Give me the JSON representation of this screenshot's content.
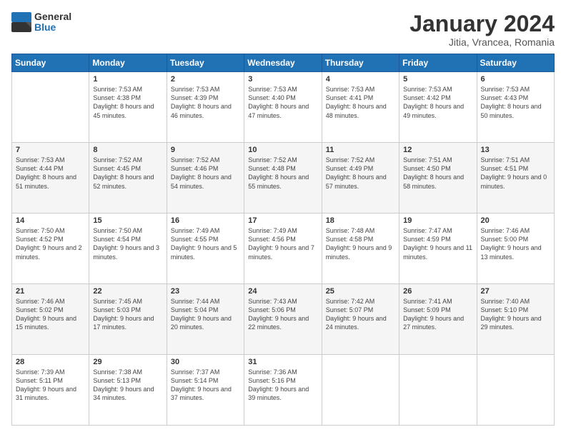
{
  "logo": {
    "general": "General",
    "blue": "Blue"
  },
  "header": {
    "month": "January 2024",
    "location": "Jitia, Vrancea, Romania"
  },
  "weekdays": [
    "Sunday",
    "Monday",
    "Tuesday",
    "Wednesday",
    "Thursday",
    "Friday",
    "Saturday"
  ],
  "weeks": [
    [
      {
        "day": "",
        "sunrise": "",
        "sunset": "",
        "daylight": ""
      },
      {
        "day": "1",
        "sunrise": "Sunrise: 7:53 AM",
        "sunset": "Sunset: 4:38 PM",
        "daylight": "Daylight: 8 hours and 45 minutes."
      },
      {
        "day": "2",
        "sunrise": "Sunrise: 7:53 AM",
        "sunset": "Sunset: 4:39 PM",
        "daylight": "Daylight: 8 hours and 46 minutes."
      },
      {
        "day": "3",
        "sunrise": "Sunrise: 7:53 AM",
        "sunset": "Sunset: 4:40 PM",
        "daylight": "Daylight: 8 hours and 47 minutes."
      },
      {
        "day": "4",
        "sunrise": "Sunrise: 7:53 AM",
        "sunset": "Sunset: 4:41 PM",
        "daylight": "Daylight: 8 hours and 48 minutes."
      },
      {
        "day": "5",
        "sunrise": "Sunrise: 7:53 AM",
        "sunset": "Sunset: 4:42 PM",
        "daylight": "Daylight: 8 hours and 49 minutes."
      },
      {
        "day": "6",
        "sunrise": "Sunrise: 7:53 AM",
        "sunset": "Sunset: 4:43 PM",
        "daylight": "Daylight: 8 hours and 50 minutes."
      }
    ],
    [
      {
        "day": "7",
        "sunrise": "Sunrise: 7:53 AM",
        "sunset": "Sunset: 4:44 PM",
        "daylight": "Daylight: 8 hours and 51 minutes."
      },
      {
        "day": "8",
        "sunrise": "Sunrise: 7:52 AM",
        "sunset": "Sunset: 4:45 PM",
        "daylight": "Daylight: 8 hours and 52 minutes."
      },
      {
        "day": "9",
        "sunrise": "Sunrise: 7:52 AM",
        "sunset": "Sunset: 4:46 PM",
        "daylight": "Daylight: 8 hours and 54 minutes."
      },
      {
        "day": "10",
        "sunrise": "Sunrise: 7:52 AM",
        "sunset": "Sunset: 4:48 PM",
        "daylight": "Daylight: 8 hours and 55 minutes."
      },
      {
        "day": "11",
        "sunrise": "Sunrise: 7:52 AM",
        "sunset": "Sunset: 4:49 PM",
        "daylight": "Daylight: 8 hours and 57 minutes."
      },
      {
        "day": "12",
        "sunrise": "Sunrise: 7:51 AM",
        "sunset": "Sunset: 4:50 PM",
        "daylight": "Daylight: 8 hours and 58 minutes."
      },
      {
        "day": "13",
        "sunrise": "Sunrise: 7:51 AM",
        "sunset": "Sunset: 4:51 PM",
        "daylight": "Daylight: 9 hours and 0 minutes."
      }
    ],
    [
      {
        "day": "14",
        "sunrise": "Sunrise: 7:50 AM",
        "sunset": "Sunset: 4:52 PM",
        "daylight": "Daylight: 9 hours and 2 minutes."
      },
      {
        "day": "15",
        "sunrise": "Sunrise: 7:50 AM",
        "sunset": "Sunset: 4:54 PM",
        "daylight": "Daylight: 9 hours and 3 minutes."
      },
      {
        "day": "16",
        "sunrise": "Sunrise: 7:49 AM",
        "sunset": "Sunset: 4:55 PM",
        "daylight": "Daylight: 9 hours and 5 minutes."
      },
      {
        "day": "17",
        "sunrise": "Sunrise: 7:49 AM",
        "sunset": "Sunset: 4:56 PM",
        "daylight": "Daylight: 9 hours and 7 minutes."
      },
      {
        "day": "18",
        "sunrise": "Sunrise: 7:48 AM",
        "sunset": "Sunset: 4:58 PM",
        "daylight": "Daylight: 9 hours and 9 minutes."
      },
      {
        "day": "19",
        "sunrise": "Sunrise: 7:47 AM",
        "sunset": "Sunset: 4:59 PM",
        "daylight": "Daylight: 9 hours and 11 minutes."
      },
      {
        "day": "20",
        "sunrise": "Sunrise: 7:46 AM",
        "sunset": "Sunset: 5:00 PM",
        "daylight": "Daylight: 9 hours and 13 minutes."
      }
    ],
    [
      {
        "day": "21",
        "sunrise": "Sunrise: 7:46 AM",
        "sunset": "Sunset: 5:02 PM",
        "daylight": "Daylight: 9 hours and 15 minutes."
      },
      {
        "day": "22",
        "sunrise": "Sunrise: 7:45 AM",
        "sunset": "Sunset: 5:03 PM",
        "daylight": "Daylight: 9 hours and 17 minutes."
      },
      {
        "day": "23",
        "sunrise": "Sunrise: 7:44 AM",
        "sunset": "Sunset: 5:04 PM",
        "daylight": "Daylight: 9 hours and 20 minutes."
      },
      {
        "day": "24",
        "sunrise": "Sunrise: 7:43 AM",
        "sunset": "Sunset: 5:06 PM",
        "daylight": "Daylight: 9 hours and 22 minutes."
      },
      {
        "day": "25",
        "sunrise": "Sunrise: 7:42 AM",
        "sunset": "Sunset: 5:07 PM",
        "daylight": "Daylight: 9 hours and 24 minutes."
      },
      {
        "day": "26",
        "sunrise": "Sunrise: 7:41 AM",
        "sunset": "Sunset: 5:09 PM",
        "daylight": "Daylight: 9 hours and 27 minutes."
      },
      {
        "day": "27",
        "sunrise": "Sunrise: 7:40 AM",
        "sunset": "Sunset: 5:10 PM",
        "daylight": "Daylight: 9 hours and 29 minutes."
      }
    ],
    [
      {
        "day": "28",
        "sunrise": "Sunrise: 7:39 AM",
        "sunset": "Sunset: 5:11 PM",
        "daylight": "Daylight: 9 hours and 31 minutes."
      },
      {
        "day": "29",
        "sunrise": "Sunrise: 7:38 AM",
        "sunset": "Sunset: 5:13 PM",
        "daylight": "Daylight: 9 hours and 34 minutes."
      },
      {
        "day": "30",
        "sunrise": "Sunrise: 7:37 AM",
        "sunset": "Sunset: 5:14 PM",
        "daylight": "Daylight: 9 hours and 37 minutes."
      },
      {
        "day": "31",
        "sunrise": "Sunrise: 7:36 AM",
        "sunset": "Sunset: 5:16 PM",
        "daylight": "Daylight: 9 hours and 39 minutes."
      },
      {
        "day": "",
        "sunrise": "",
        "sunset": "",
        "daylight": ""
      },
      {
        "day": "",
        "sunrise": "",
        "sunset": "",
        "daylight": ""
      },
      {
        "day": "",
        "sunrise": "",
        "sunset": "",
        "daylight": ""
      }
    ]
  ]
}
